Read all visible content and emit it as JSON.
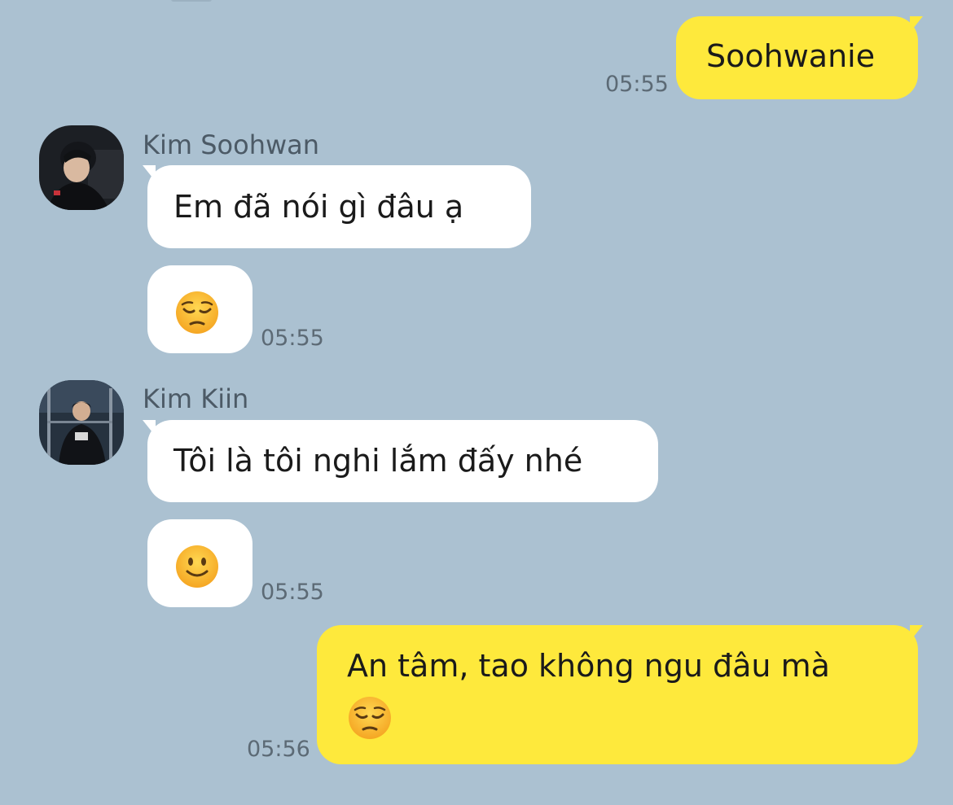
{
  "messages": [
    {
      "side": "mine",
      "text": "Soohwanie",
      "time": "05:55"
    },
    {
      "side": "theirs",
      "sender": "Kim Soohwan",
      "text": "Em đã nói gì đâu ạ"
    },
    {
      "side": "theirs",
      "emoji": "pensive-face",
      "time": "05:55"
    },
    {
      "side": "theirs",
      "sender": "Kim Kiin",
      "text": "Tôi là tôi nghi lắm đấy nhé"
    },
    {
      "side": "theirs",
      "emoji": "slightly-smiling-face",
      "time": "05:55"
    },
    {
      "side": "mine",
      "text": "An tâm, tao không ngu đâu mà",
      "emoji": "pensive-face",
      "time": "05:56"
    }
  ],
  "colors": {
    "background": "#abc1d1",
    "mine_bubble": "#fee93c",
    "theirs_bubble": "#ffffff"
  }
}
